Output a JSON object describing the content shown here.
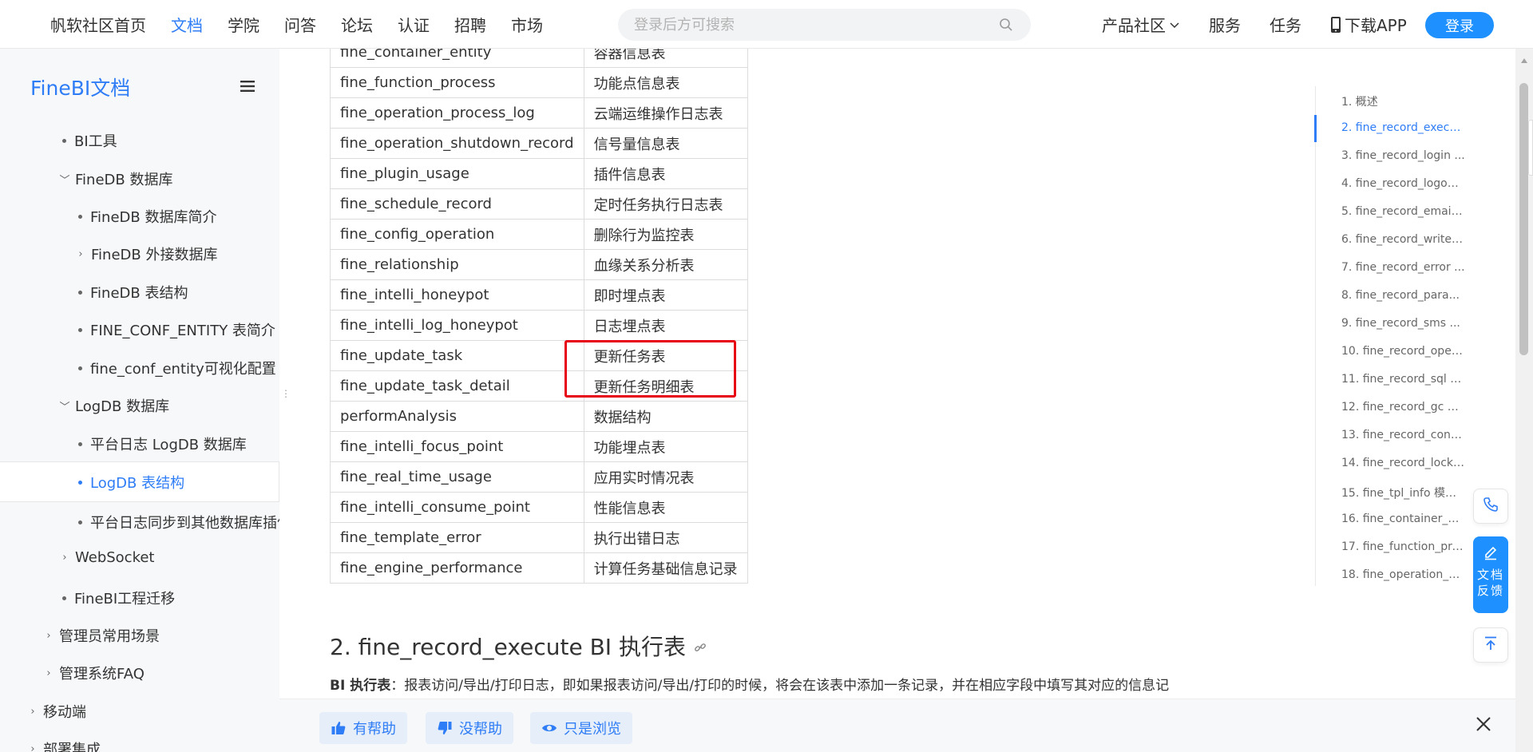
{
  "nav": {
    "items": [
      "帆软社区首页",
      "文档",
      "学院",
      "问答",
      "论坛",
      "认证",
      "招聘",
      "市场"
    ],
    "active_index": 1,
    "search_placeholder": "登录后方可搜索",
    "right_items": [
      "产品社区",
      "服务",
      "任务",
      "下载APP"
    ],
    "login_label": "登录"
  },
  "sidebar": {
    "title": "FineBI文档",
    "items": [
      {
        "label": "BI工具",
        "kind": "dot"
      },
      {
        "label": "FineDB 数据库",
        "kind": "expanded"
      },
      {
        "label": "FineDB 数据库简介",
        "kind": "dot"
      },
      {
        "label": "FineDB 外接数据库",
        "kind": "collapsed"
      },
      {
        "label": "FineDB 表结构",
        "kind": "dot"
      },
      {
        "label": "FINE_CONF_ENTITY 表简介",
        "kind": "dot"
      },
      {
        "label": "fine_conf_entity可视化配置",
        "kind": "dot"
      },
      {
        "label": "LogDB 数据库",
        "kind": "expanded"
      },
      {
        "label": "平台日志 LogDB 数据库",
        "kind": "dot"
      },
      {
        "label": "LogDB 表结构",
        "kind": "dot",
        "active": true
      },
      {
        "label": "平台日志同步到其他数据库插件",
        "kind": "dot"
      },
      {
        "label": "WebSocket",
        "kind": "collapsed"
      },
      {
        "label": "FineBI工程迁移",
        "kind": "dot"
      },
      {
        "label": "管理员常用场景",
        "kind": "collapsed"
      },
      {
        "label": "管理系统FAQ",
        "kind": "collapsed"
      },
      {
        "label": "移动端",
        "kind": "collapsed"
      },
      {
        "label": "部署集成",
        "kind": "collapsed"
      }
    ]
  },
  "table": {
    "rows": [
      [
        "fine_container_entity",
        "容器信息表"
      ],
      [
        "fine_function_process",
        "功能点信息表"
      ],
      [
        "fine_operation_process_log",
        "云端运维操作日志表"
      ],
      [
        "fine_operation_shutdown_record",
        "信号量信息表"
      ],
      [
        "fine_plugin_usage",
        "插件信息表"
      ],
      [
        "fine_schedule_record",
        "定时任务执行日志表"
      ],
      [
        "fine_config_operation",
        "删除行为监控表"
      ],
      [
        "fine_relationship",
        "血缘关系分析表"
      ],
      [
        "fine_intelli_honeypot",
        "即时埋点表"
      ],
      [
        "fine_intelli_log_honeypot",
        "日志埋点表"
      ],
      [
        "fine_update_task",
        "更新任务表"
      ],
      [
        "fine_update_task_detail",
        "更新任务明细表"
      ],
      [
        "performAnalysis",
        "数据结构"
      ],
      [
        "fine_intelli_focus_point",
        "功能埋点表"
      ],
      [
        "fine_real_time_usage",
        "应用实时情况表"
      ],
      [
        "fine_intelli_consume_point",
        "性能信息表"
      ],
      [
        "fine_template_error",
        "执行出错日志"
      ],
      [
        "fine_engine_performance",
        "计算任务基础信息记录"
      ]
    ]
  },
  "section": {
    "heading": "2. fine_record_execute BI 执行表",
    "desc_bold": "BI 执行表",
    "desc_text": "：报表访问/导出/打印日志，即如果报表访问/导出/打印的时候，将会在该表中添加一条记录，并在相应字段中填写其对应的信息记"
  },
  "toc": {
    "items": [
      "1. 概述",
      "2. fine_record_execu...",
      "3. fine_record_login ...",
      "4. fine_record_logout...",
      "5. fine_record_email ...",
      "6. fine_record_write ...",
      "7. fine_record_error ...",
      "8. fine_record_para...",
      "9. fine_record_sms ...",
      "10. fine_record_oper...",
      "11. fine_record_sql S...",
      "12. fine_record_gc G...",
      "13. fine_record_conf ...",
      "14. fine_record_lock ...",
      "15. fine_tpl_info 模板...",
      "16. fine_container_e...",
      "17. fine_function_pro...",
      "18. fine_operation_p..."
    ],
    "active_index": 1
  },
  "float": {
    "feedback_label": "文档反馈"
  },
  "helpbar": {
    "helpful": "有帮助",
    "not_helpful": "没帮助",
    "just_browsing": "只是浏览"
  },
  "colors": {
    "accent": "#2f7df6",
    "login_bg": "#1e90ff",
    "highlight": "#e60012"
  }
}
